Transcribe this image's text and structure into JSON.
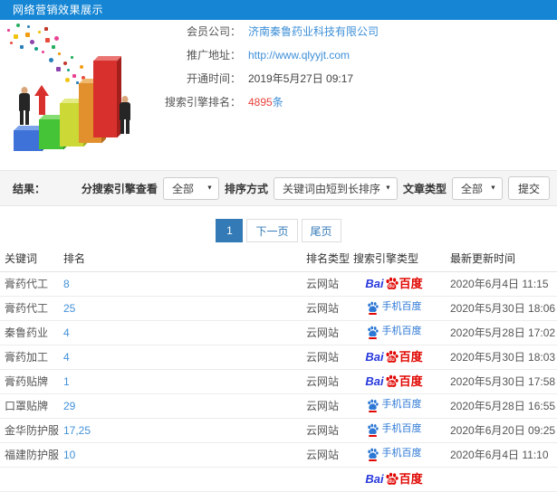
{
  "header": {
    "title": "网络营销效果展示"
  },
  "account": {
    "company_label": "会员公司：",
    "company_value": "济南秦鲁药业科技有限公司",
    "site_label": "推广地址：",
    "site_value": "http://www.qlyyjt.com",
    "opened_label": "开通时间：",
    "opened_value": "2019年5月27日 09:17",
    "rank_label": "搜索引擎排名：",
    "rank_count": "4895",
    "rank_unit": "条"
  },
  "illustration": {
    "name": "3d-bar-chart-growth-clipart"
  },
  "filters": {
    "result_label": "结果：",
    "engine_label": "分搜索引擎查看",
    "engine_value": "全部",
    "sort_label": "排序方式",
    "sort_value": "关键词由短到长排序",
    "article_label": "文章类型",
    "article_value": "全部",
    "submit_label": "提交"
  },
  "pagination": {
    "page": "1",
    "next_label": "下一页",
    "last_label": "尾页"
  },
  "table": {
    "headers": [
      "关键词",
      "排名",
      "排名类型",
      "搜索引擎类型",
      "最新更新时间"
    ],
    "rows": [
      {
        "keyword": "膏药代工",
        "rank": "8",
        "rank_type": "云网站",
        "engine": "baidu",
        "updated": "2020年6月4日 11:15"
      },
      {
        "keyword": "膏药代工",
        "rank": "25",
        "rank_type": "云网站",
        "engine": "mobile-baidu",
        "updated": "2020年5月30日 18:06"
      },
      {
        "keyword": "秦鲁药业",
        "rank": "4",
        "rank_type": "云网站",
        "engine": "mobile-baidu",
        "updated": "2020年5月28日 17:02"
      },
      {
        "keyword": "膏药加工",
        "rank": "4",
        "rank_type": "云网站",
        "engine": "baidu",
        "updated": "2020年5月30日 18:03"
      },
      {
        "keyword": "膏药贴牌",
        "rank": "1",
        "rank_type": "云网站",
        "engine": "baidu",
        "updated": "2020年5月30日 17:58"
      },
      {
        "keyword": "口罩贴牌",
        "rank": "29",
        "rank_type": "云网站",
        "engine": "mobile-baidu",
        "updated": "2020年5月28日 16:55"
      },
      {
        "keyword": "金华防护服",
        "rank": "17,25",
        "rank_type": "云网站",
        "engine": "mobile-baidu",
        "updated": "2020年6月20日 09:25"
      },
      {
        "keyword": "福建防护服",
        "rank": "10",
        "rank_type": "云网站",
        "engine": "mobile-baidu",
        "updated": "2020年6月4日 11:10"
      },
      {
        "keyword": "",
        "rank": "",
        "rank_type": "",
        "engine": "baidu",
        "updated": ""
      }
    ]
  },
  "logos": {
    "baidu": {
      "prefix": "Bai",
      "paw_text": "du",
      "suffix": "百度"
    },
    "mobile_baidu": {
      "label": "手机百度"
    }
  },
  "colors": {
    "header_bg": "#1686d4",
    "link_blue": "#3d8fd8",
    "accent_red": "#e8413c",
    "pagination_active": "#337ab7",
    "baidu_blue": "#2839dd",
    "baidu_red": "#e10601",
    "mobile_baidu_blue": "#2d78d5"
  }
}
